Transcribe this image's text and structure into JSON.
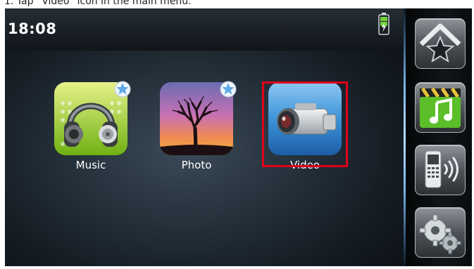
{
  "caption": "1. Tap “Video” icon in the main menu.",
  "status_bar": {
    "time": "18:08",
    "battery_icon": "battery-charging-icon"
  },
  "apps": [
    {
      "label": "Music",
      "icon": "headphones-icon",
      "favorite": true
    },
    {
      "label": "Photo",
      "icon": "tree-sunset-icon",
      "favorite": true
    },
    {
      "label": "Video",
      "icon": "camcorder-icon",
      "favorite": false,
      "highlighted": true
    }
  ],
  "sidebar": [
    {
      "icon": "favorites-star-icon"
    },
    {
      "icon": "multimedia-icon"
    },
    {
      "icon": "bluetooth-phone-icon"
    },
    {
      "icon": "settings-gears-icon"
    }
  ],
  "colors": {
    "highlight": "#e0001a",
    "accent_green": "#7cc521",
    "accent_blue": "#2f88d4"
  }
}
